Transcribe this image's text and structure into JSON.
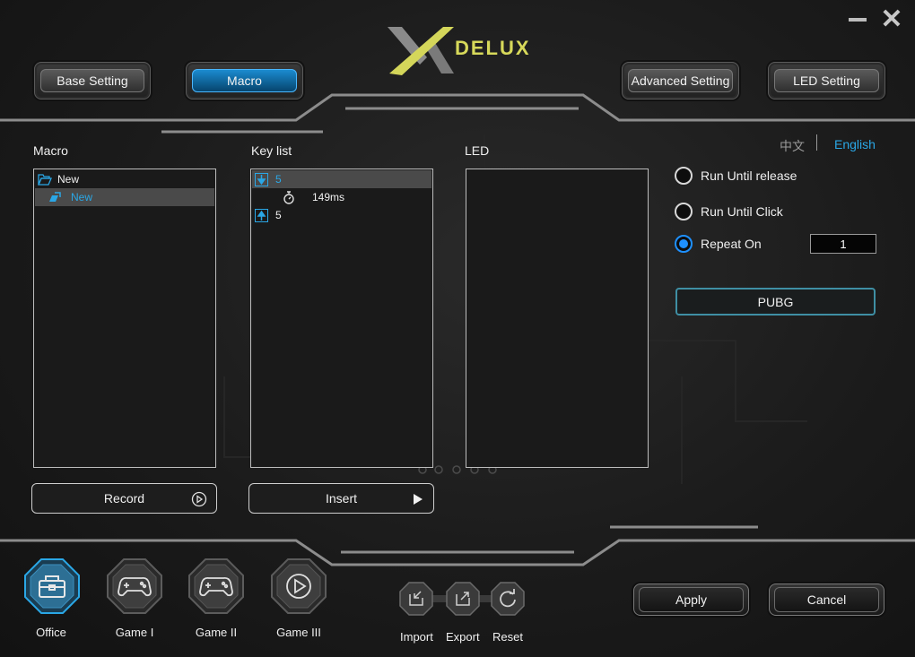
{
  "window": {
    "close_glyph": "✕"
  },
  "logo": {
    "text": "DELUX"
  },
  "tabs": [
    {
      "label": "Base Setting",
      "active": false
    },
    {
      "label": "Macro",
      "active": true
    },
    {
      "label": "Advanced Setting",
      "active": false
    },
    {
      "label": "LED Setting",
      "active": false
    }
  ],
  "language": {
    "chinese": "中文",
    "english": "English",
    "selected": "English"
  },
  "macro_panel": {
    "title": "Macro",
    "items": [
      {
        "label": "New",
        "icon": "folder-open-icon",
        "selected": false
      },
      {
        "label": "New",
        "icon": "macro-file-icon",
        "selected": true
      }
    ],
    "record_label": "Record"
  },
  "keylist_panel": {
    "title": "Key list",
    "items": [
      {
        "type": "key-down",
        "icon": "arrow-down-icon",
        "label": "5",
        "selected": true
      },
      {
        "type": "delay",
        "icon": "stopwatch-icon",
        "label": "149ms",
        "selected": false
      },
      {
        "type": "key-up",
        "icon": "arrow-up-icon",
        "label": "5",
        "selected": false
      }
    ],
    "insert_label": "Insert"
  },
  "led_panel": {
    "title": "LED"
  },
  "run_options": {
    "run_until_release": "Run Until release",
    "run_until_click": "Run Until Click",
    "repeat_on": "Repeat On",
    "selected": "repeat_on",
    "repeat_count": "1"
  },
  "profile_button": "PUBG",
  "modes": [
    {
      "label": "Office",
      "icon": "toolbox-icon",
      "active": true
    },
    {
      "label": "Game I",
      "icon": "gamepad-icon",
      "active": false
    },
    {
      "label": "Game II",
      "icon": "gamepad-icon",
      "active": false
    },
    {
      "label": "Game III",
      "icon": "play-circle-icon",
      "active": false
    }
  ],
  "file_actions": {
    "import": "Import",
    "export": "Export",
    "reset": "Reset"
  },
  "footer": {
    "apply": "Apply",
    "cancel": "Cancel"
  },
  "colors": {
    "accent_blue": "#1e90ff",
    "logo_yellow": "#d7d95a",
    "selected_row": "#4a4a4a",
    "link_blue": "#2aa7e6"
  }
}
